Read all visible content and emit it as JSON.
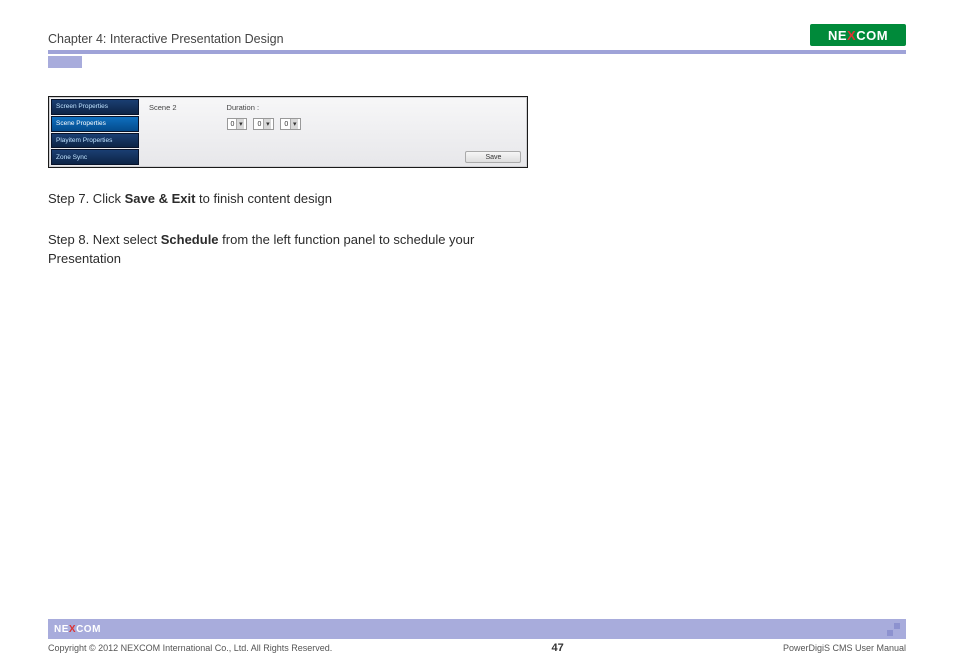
{
  "header": {
    "chapter_title": "Chapter 4: Interactive Presentation Design",
    "brand_before": "NE",
    "brand_accent": "X",
    "brand_after": "COM"
  },
  "ui": {
    "side_items": [
      {
        "label": "Screen Properties",
        "selected": false
      },
      {
        "label": "Scene Properties",
        "selected": true
      },
      {
        "label": "Playitem Properties",
        "selected": false
      },
      {
        "label": "Zone Sync",
        "selected": false
      }
    ],
    "scene_label": "Scene 2",
    "duration_label": "Duration :",
    "duration_values": [
      "0",
      "0",
      "0"
    ],
    "save_button": "Save"
  },
  "steps": {
    "s7_pre": "Step 7. Click ",
    "s7_bold": "Save & Exit",
    "s7_post": " to finish content design",
    "s8_pre": "Step 8. Next select ",
    "s8_bold": "Schedule",
    "s8_post": " from the left function panel to schedule your Presentation"
  },
  "footer": {
    "brand_before": "NE",
    "brand_accent": "X",
    "brand_after": "COM",
    "copyright": "Copyright © 2012 NEXCOM International Co., Ltd. All Rights Reserved.",
    "page_number": "47",
    "doc_title": "PowerDigiS CMS User Manual"
  }
}
